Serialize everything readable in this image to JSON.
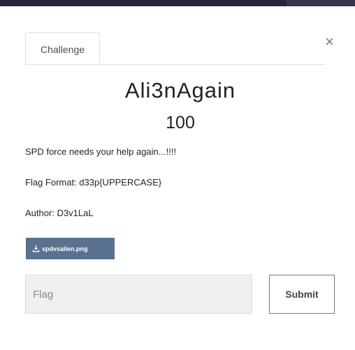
{
  "modal": {
    "tab_label": "Challenge",
    "close_glyph": "×",
    "title": "Ali3nAgain",
    "points": "100",
    "description": "SPD force needs your help again...!!!!",
    "flag_format": "Flag Format: d33p{UPPERCASE}",
    "author": "Author: D3v1LaL",
    "file_name": "spdvsalien.png",
    "flag_placeholder": "Flag",
    "submit_label": "Submit"
  },
  "colors": {
    "file_button": "#5b7190",
    "top_strip": "#2a2438"
  },
  "icons": {
    "download": "download-icon",
    "close": "close-icon"
  }
}
